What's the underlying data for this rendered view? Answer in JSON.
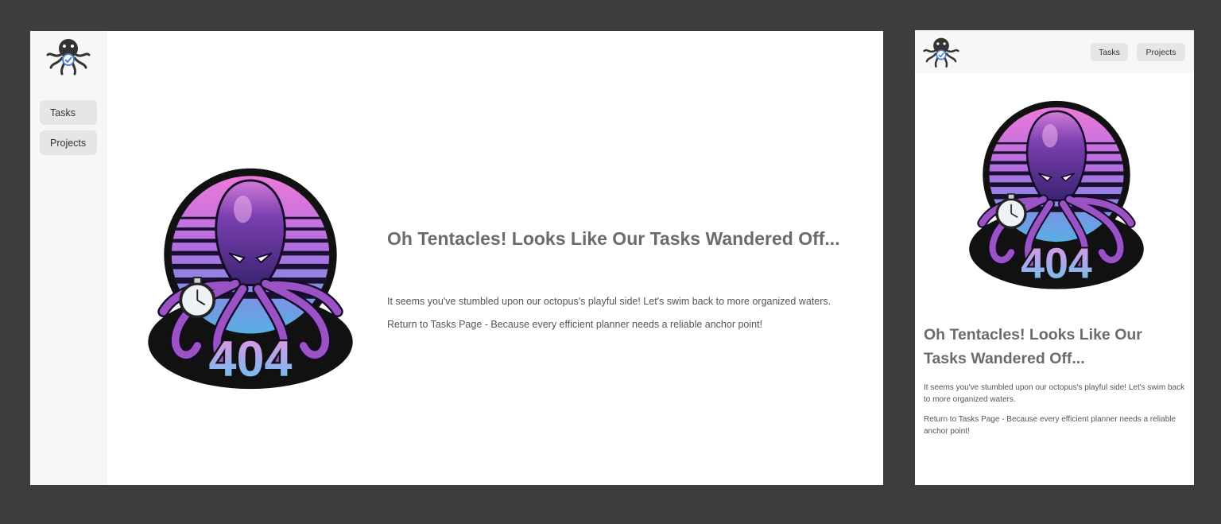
{
  "nav": {
    "tasks_label": "Tasks",
    "projects_label": "Projects"
  },
  "error_page": {
    "heading": "Oh Tentacles! Looks Like Our Tasks Wandered Off...",
    "message": "It seems you've stumbled upon our octopus's playful side! Let's swim back to more organized waters.",
    "return_text": "Return to Tasks Page - Because every efficient planner needs a reliable anchor point!",
    "badge_text": "404"
  },
  "icons": {
    "logo": "octopus-logo-icon",
    "illustration": "octopus-404-illustration",
    "stopwatch": "stopwatch-icon"
  },
  "colors": {
    "backdrop": "#3d3d3d",
    "sidebar_bg": "#f7f7f7",
    "nav_button_bg": "#e6e6e6",
    "heading": "#6b6b6b",
    "badge_pink": "#e58ae0",
    "badge_cyan": "#5ec8ea",
    "octopus_purple": "#6a3fa6"
  }
}
